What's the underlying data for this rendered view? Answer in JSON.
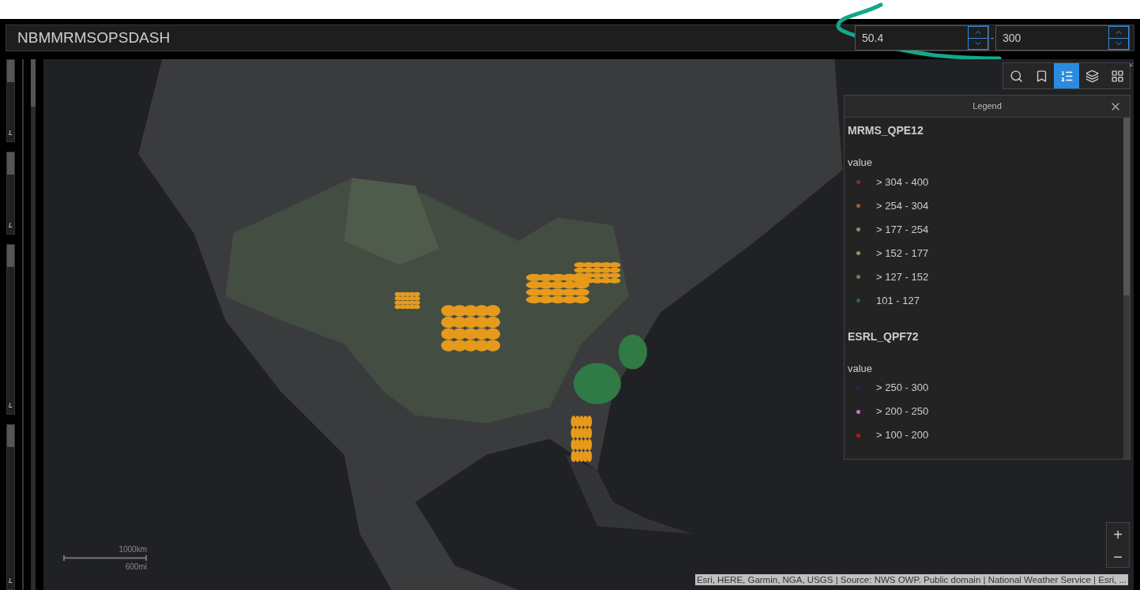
{
  "header": {
    "title": "NBMMRMSOPSDASH",
    "range": {
      "min": "50.4",
      "separator": "-",
      "max": "300"
    }
  },
  "side_panels": [
    {
      "label": "L"
    },
    {
      "label": "L"
    },
    {
      "label": "L"
    },
    {
      "label": "L"
    }
  ],
  "toolbar": [
    {
      "kind": "search",
      "selected": false
    },
    {
      "kind": "bookmark",
      "selected": false
    },
    {
      "kind": "legend",
      "selected": true
    },
    {
      "kind": "layers",
      "selected": false
    },
    {
      "kind": "basemap",
      "selected": false
    }
  ],
  "legend": {
    "title": "Legend",
    "layers": [
      {
        "name": "MRMS_QPE12",
        "field": "value",
        "items": [
          {
            "label": "> 304 - 400",
            "color": "#8b2a22"
          },
          {
            "label": "> 254 - 304",
            "color": "#a0603a"
          },
          {
            "label": "> 177 - 254",
            "color": "#9c8a5a"
          },
          {
            "label": "> 152 - 177",
            "color": "#8a9a5e"
          },
          {
            "label": "> 127 - 152",
            "color": "#5e8a45"
          },
          {
            "label": "101 - 127",
            "color": "#2e6a3c"
          }
        ]
      },
      {
        "name": "ESRL_QPF72",
        "field": "value",
        "items": [
          {
            "label": "> 250 - 300",
            "color": "#4a1070"
          },
          {
            "label": "> 200 - 250",
            "color": "#d070d0"
          },
          {
            "label": "> 100 - 200",
            "color": "#d01010"
          }
        ]
      }
    ]
  },
  "map": {
    "kind": "picture",
    "scale": {
      "metric": "1000km",
      "imperial": "600mi"
    },
    "zoom": {
      "in": "+",
      "out": "−"
    },
    "attribution": "Esri, HERE, Garmin, NGA, USGS | Source: NWS OWP. Public domain | National Weather Service | Esri, ..."
  }
}
